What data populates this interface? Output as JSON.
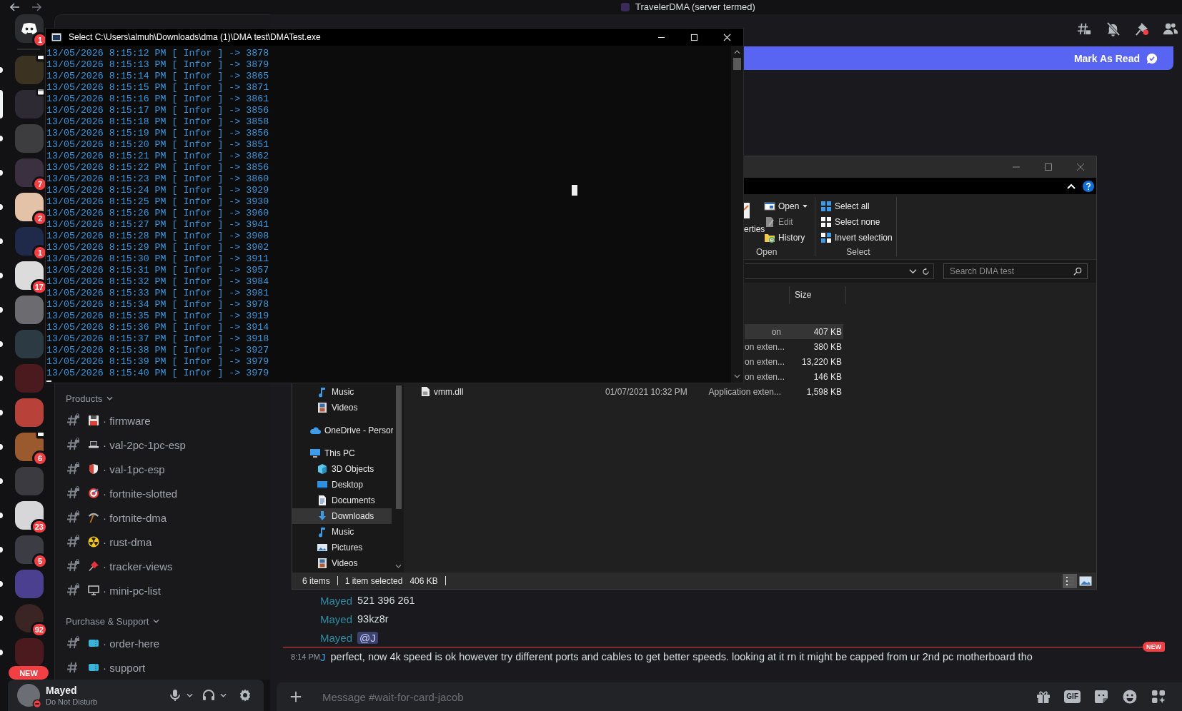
{
  "titlebar": {
    "title": "TravelerDMA (server termed)"
  },
  "servers": [
    {
      "kind": "home",
      "unread": false,
      "selected": false,
      "sharing": false,
      "event": false,
      "badge": "1"
    },
    {
      "kind": "server",
      "unread": true,
      "selected": false,
      "sharing": true,
      "event": false
    },
    {
      "kind": "server",
      "unread": false,
      "selected": true,
      "sharing": false,
      "event": true
    },
    {
      "kind": "server",
      "unread": true,
      "selected": false,
      "sharing": false,
      "event": false
    },
    {
      "kind": "server",
      "unread": true,
      "selected": false,
      "sharing": false,
      "event": false,
      "badge": "7"
    },
    {
      "kind": "server",
      "unread": true,
      "selected": false,
      "sharing": false,
      "event": false,
      "badge": "2"
    },
    {
      "kind": "server",
      "unread": true,
      "selected": false,
      "sharing": false,
      "event": false,
      "badge": "1"
    },
    {
      "kind": "server",
      "unread": true,
      "selected": false,
      "sharing": false,
      "event": false,
      "badge": "17"
    },
    {
      "kind": "server",
      "unread": true,
      "selected": false,
      "sharing": false,
      "event": false
    },
    {
      "kind": "server",
      "unread": true,
      "selected": false,
      "sharing": false,
      "event": false
    },
    {
      "kind": "server",
      "unread": true,
      "selected": false,
      "sharing": false,
      "event": false
    },
    {
      "kind": "server",
      "unread": true,
      "selected": false,
      "sharing": false,
      "event": false
    },
    {
      "kind": "server",
      "unread": true,
      "selected": false,
      "sharing": true,
      "event": false,
      "badge": "6"
    },
    {
      "kind": "server",
      "unread": true,
      "selected": false,
      "sharing": false,
      "event": false
    },
    {
      "kind": "server",
      "unread": true,
      "selected": false,
      "sharing": false,
      "event": false,
      "badge": "23"
    },
    {
      "kind": "server",
      "unread": true,
      "selected": false,
      "sharing": false,
      "event": false,
      "badge": "5"
    },
    {
      "kind": "server",
      "unread": true,
      "selected": false,
      "sharing": false,
      "event": false
    },
    {
      "kind": "server",
      "unread": true,
      "selected": false,
      "sharing": false,
      "event": false,
      "badge": "92"
    },
    {
      "kind": "server",
      "unread": true,
      "selected": false,
      "sharing": false,
      "event": false
    }
  ],
  "new_pill": "NEW",
  "sidebar": {
    "categories": [
      {
        "name": "Products",
        "expanded": true,
        "channels": [
          {
            "name": "· firmware",
            "locked": true
          },
          {
            "name": "· val-2pc-1pc-esp",
            "locked": true
          },
          {
            "name": "· val-1pc-esp",
            "locked": true
          },
          {
            "name": "· fortnite-slotted",
            "locked": true
          },
          {
            "name": "· fortnite-dma",
            "locked": true
          },
          {
            "name": "· rust-dma",
            "locked": true
          },
          {
            "name": "· tracker-views",
            "locked": true
          },
          {
            "name": "· mini-pc-list",
            "locked": true
          }
        ]
      },
      {
        "name": "Purchase & Support",
        "expanded": true,
        "channels": [
          {
            "name": "· order-here",
            "locked": true
          },
          {
            "name": "· support",
            "locked": false
          }
        ]
      }
    ]
  },
  "user": {
    "name": "Mayed",
    "status": "Do Not Disturb"
  },
  "chat": {
    "banner": {
      "action": "Mark As Read"
    },
    "messages": [
      {
        "author": "Mayed",
        "color": "#2f8aa3",
        "kind": "text",
        "text": "521 396 261"
      },
      {
        "author": "Mayed",
        "color": "#2f8aa3",
        "kind": "text",
        "text": "93kz8r"
      },
      {
        "author": "Mayed",
        "color": "#2f8aa3",
        "kind": "mention",
        "text": "@J"
      }
    ],
    "new_divider": "NEW",
    "new_messages": [
      {
        "time": "8:14 PM",
        "author": "J",
        "color": "#3aa0f0",
        "kind": "text",
        "text": "perfect, now 4k speed is ok however try different ports and cables to get better speeds. looking at it rn it might be capped from ur 2nd pc motherboard tho"
      }
    ],
    "composer": {
      "placeholder": "Message #wait-for-card-jacob",
      "gif": "GIF"
    }
  },
  "console": {
    "title": "Select C:\\Users\\almuh\\Downloads\\dma (1)\\DMA test\\DMATest.exe",
    "lines": [
      "13/05/2026 8:15:12 PM [ Infor ] -> 3878",
      "13/05/2026 8:15:13 PM [ Infor ] -> 3879",
      "13/05/2026 8:15:14 PM [ Infor ] -> 3865",
      "13/05/2026 8:15:15 PM [ Infor ] -> 3871",
      "13/05/2026 8:15:16 PM [ Infor ] -> 3861",
      "13/05/2026 8:15:17 PM [ Infor ] -> 3856",
      "13/05/2026 8:15:18 PM [ Infor ] -> 3858",
      "13/05/2026 8:15:19 PM [ Infor ] -> 3856",
      "13/05/2026 8:15:20 PM [ Infor ] -> 3851",
      "13/05/2026 8:15:21 PM [ Infor ] -> 3862",
      "13/05/2026 8:15:22 PM [ Infor ] -> 3856",
      "13/05/2026 8:15:23 PM [ Infor ] -> 3860",
      "13/05/2026 8:15:24 PM [ Infor ] -> 3929",
      "13/05/2026 8:15:25 PM [ Infor ] -> 3930",
      "13/05/2026 8:15:26 PM [ Infor ] -> 3960",
      "13/05/2026 8:15:27 PM [ Infor ] -> 3941",
      "13/05/2026 8:15:28 PM [ Infor ] -> 3908",
      "13/05/2026 8:15:29 PM [ Infor ] -> 3902",
      "13/05/2026 8:15:30 PM [ Infor ] -> 3911",
      "13/05/2026 8:15:31 PM [ Infor ] -> 3957",
      "13/05/2026 8:15:32 PM [ Infor ] -> 3984",
      "13/05/2026 8:15:33 PM [ Infor ] -> 3981",
      "13/05/2026 8:15:34 PM [ Infor ] -> 3978",
      "13/05/2026 8:15:35 PM [ Infor ] -> 3919",
      "13/05/2026 8:15:36 PM [ Infor ] -> 3914",
      "13/05/2026 8:15:37 PM [ Infor ] -> 3918",
      "13/05/2026 8:15:38 PM [ Infor ] -> 3927",
      "13/05/2026 8:15:39 PM [ Infor ] -> 3979",
      "13/05/2026 8:15:40 PM [ Infor ] -> 3979"
    ]
  },
  "explorer": {
    "ribbon": [
      {
        "label": "Open",
        "items": [
          {
            "label": "erties",
            "kind": "large",
            "disabled": false
          },
          {
            "label": "Open",
            "kind": "dropdown",
            "disabled": false
          },
          {
            "label": "Edit",
            "kind": "small",
            "disabled": true
          },
          {
            "label": "History",
            "kind": "small",
            "disabled": false
          }
        ]
      },
      {
        "label": "Select",
        "items": [
          {
            "label": "Select all",
            "kind": "small",
            "disabled": false
          },
          {
            "label": "Select none",
            "kind": "small",
            "disabled": false
          },
          {
            "label": "Invert selection",
            "kind": "small",
            "disabled": false
          }
        ]
      }
    ],
    "search": {
      "placeholder": "Search DMA test"
    },
    "columns": [
      {
        "label": "Size"
      }
    ],
    "files": [
      {
        "type": "on",
        "size": "407 KB",
        "selected": true
      },
      {
        "type": "on exten...",
        "size": "380 KB",
        "selected": false
      },
      {
        "type": "on exten...",
        "size": "13,220 KB",
        "selected": false
      },
      {
        "type": "on exten...",
        "size": "146 KB",
        "selected": false
      },
      {
        "name": "vmm.dll",
        "date": "01/07/2021 10:32 PM",
        "type": "Application exten...",
        "size": "1,598 KB",
        "selected": false
      }
    ],
    "nav": [
      {
        "children": [
          {
            "label": "Music",
            "selected": false
          },
          {
            "label": "Videos",
            "selected": false
          }
        ]
      },
      {
        "label": "OneDrive - Persor",
        "selected": false
      },
      {
        "label": "This PC",
        "selected": false,
        "children": [
          {
            "label": "3D Objects",
            "selected": false
          },
          {
            "label": "Desktop",
            "selected": false
          },
          {
            "label": "Documents",
            "selected": false
          },
          {
            "label": "Downloads",
            "selected": true
          },
          {
            "label": "Music",
            "selected": false
          },
          {
            "label": "Pictures",
            "selected": false
          },
          {
            "label": "Videos",
            "selected": false
          }
        ]
      }
    ],
    "status": {
      "count": "6 items",
      "selection": "1 item selected",
      "size": "406 KB"
    },
    "views": [
      {
        "kind": "details",
        "selected": true
      },
      {
        "kind": "preview",
        "selected": false
      }
    ]
  }
}
